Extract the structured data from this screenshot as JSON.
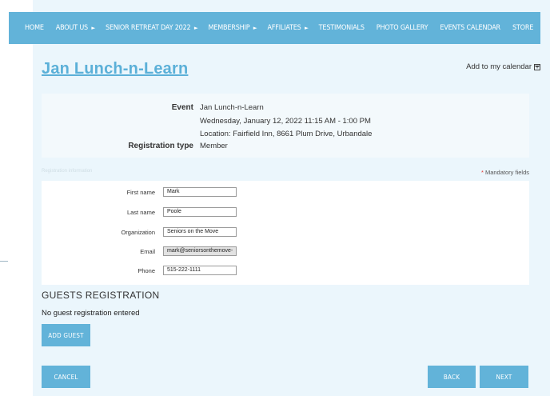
{
  "nav": {
    "items": [
      {
        "label": "HOME",
        "arrow": ""
      },
      {
        "label": "ABOUT US",
        "arrow": "►"
      },
      {
        "label": "SENIOR RETREAT DAY 2022",
        "arrow": "►"
      },
      {
        "label": "MEMBERSHIP",
        "arrow": "►"
      },
      {
        "label": "AFFILIATES",
        "arrow": "►"
      },
      {
        "label": "TESTIMONIALS",
        "arrow": ""
      },
      {
        "label": "PHOTO GALLERY",
        "arrow": ""
      },
      {
        "label": "EVENTS CALENDAR",
        "arrow": ""
      },
      {
        "label": "STORE",
        "arrow": ""
      }
    ]
  },
  "event": {
    "title": "Jan Lunch-n-Learn",
    "add_to_calendar": "Add to my calendar",
    "event_label": "Event",
    "event_name": "Jan Lunch-n-Learn",
    "event_datetime": "Wednesday, January 12, 2022 11:15 AM - 1:00 PM",
    "event_location": "Location: Fairfield Inn, 8661 Plum Drive, Urbandale",
    "registration_type_label": "Registration type",
    "registration_type": "Member"
  },
  "form": {
    "section_label": "Registration information",
    "mandatory_star": "*",
    "mandatory_text": "Mandatory fields",
    "fields": [
      {
        "label": "First name",
        "value": "Mark"
      },
      {
        "label": "Last name",
        "value": "Poole"
      },
      {
        "label": "Organization",
        "value": "Seniors on the Move"
      },
      {
        "label": "Email",
        "value": "mark@seniorsonthemove-"
      },
      {
        "label": "Phone",
        "value": "515-222-1111"
      }
    ]
  },
  "guests": {
    "title": "GUESTS REGISTRATION",
    "empty_text": "No guest registration entered",
    "add_button": "ADD GUEST"
  },
  "actions": {
    "cancel": "CANCEL",
    "back": "BACK",
    "next": "NEXT"
  },
  "colors": {
    "accent": "#62b3d9",
    "title_link": "#5bb0d8",
    "page_bg": "#ebf6fc",
    "mandatory_star": "#e3352e"
  }
}
